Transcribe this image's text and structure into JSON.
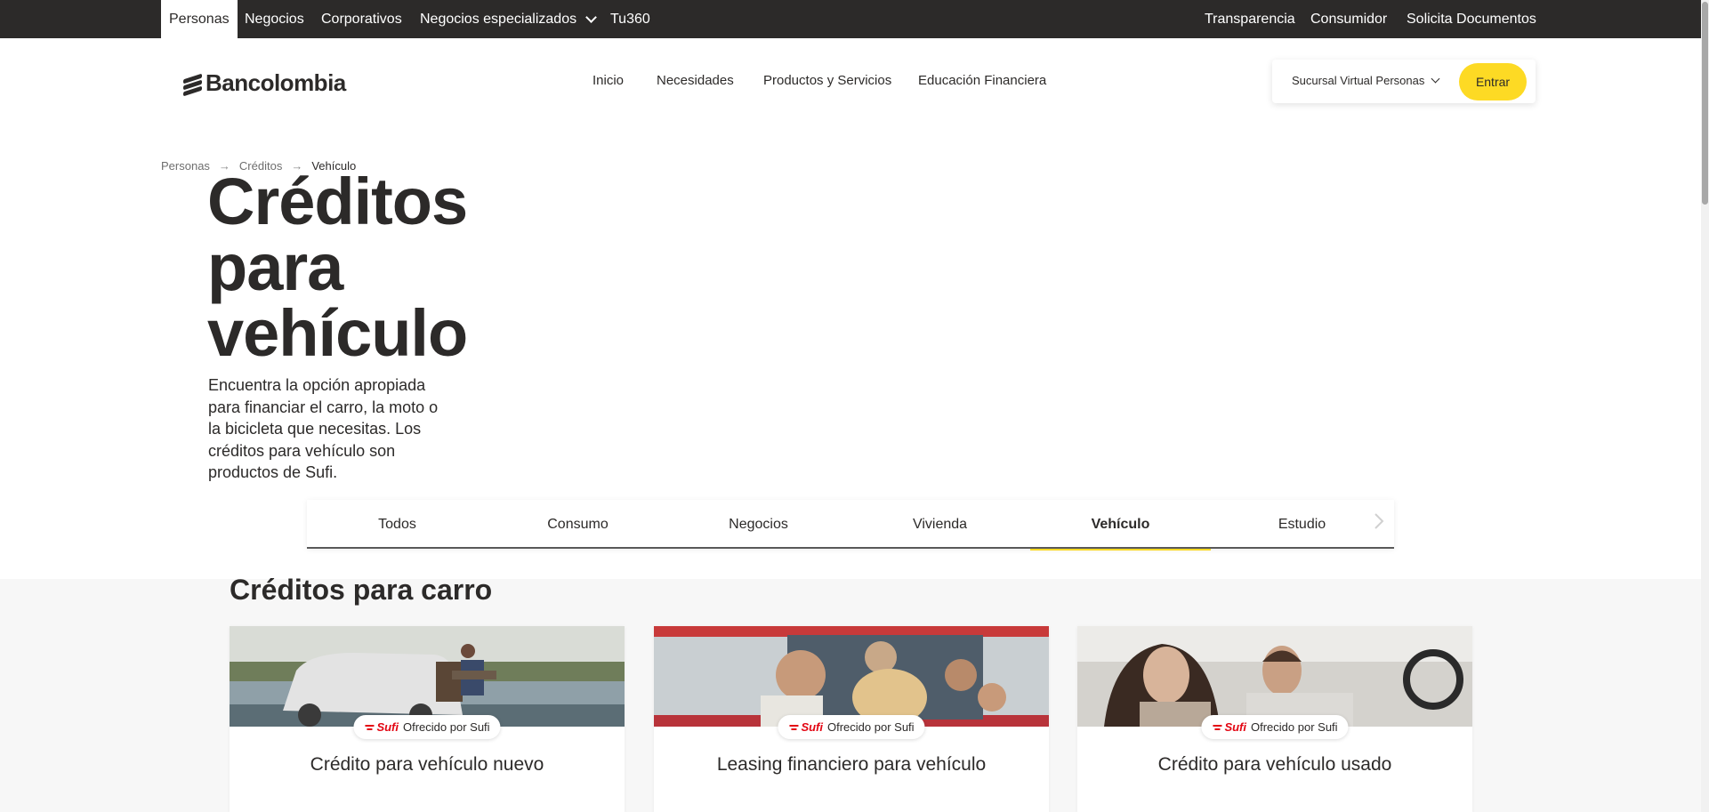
{
  "topbar": {
    "left": [
      "Personas",
      "Negocios",
      "Corporativos",
      "Negocios especializados",
      "Tu360"
    ],
    "right": [
      "Transparencia",
      "Consumidor",
      "Solicita Documentos"
    ]
  },
  "header": {
    "logo": "Bancolombia",
    "nav": [
      "Inicio",
      "Necesidades",
      "Productos y Servicios",
      "Educación Financiera"
    ],
    "sucursal": "Sucursal Virtual Personas",
    "entrar": "Entrar"
  },
  "breadcrumb": [
    "Personas",
    "Créditos",
    "Vehículo"
  ],
  "breadcrumb_separator": "→",
  "hero": {
    "title": "Créditos para vehículo",
    "description": "Encuentra la opción apropiada para financiar el carro, la moto o la bicicleta que necesitas. Los créditos para vehículo son productos de Sufi."
  },
  "tabs": [
    "Todos",
    "Consumo",
    "Negocios",
    "Vivienda",
    "Vehículo",
    "Estudio"
  ],
  "active_tab": "Vehículo",
  "section_title": "Créditos para carro",
  "cards": [
    {
      "brand": "Sufi",
      "badge": "Ofrecido por Sufi",
      "title": "Crédito para vehículo nuevo"
    },
    {
      "brand": "Sufi",
      "badge": "Ofrecido por Sufi",
      "title": "Leasing financiero para vehículo"
    },
    {
      "brand": "Sufi",
      "badge": "Ofrecido por Sufi",
      "title": "Crédito para vehículo usado"
    }
  ],
  "colors": {
    "topbar": "#2c2a29",
    "accent": "#fdda24",
    "sufi": "#e30613",
    "section_bg": "#f7f7f7"
  },
  "icons": [
    "chevron-down-icon",
    "breadcrumb-arrow-icon",
    "chevron-right-icon",
    "sufi-logo-icon"
  ]
}
